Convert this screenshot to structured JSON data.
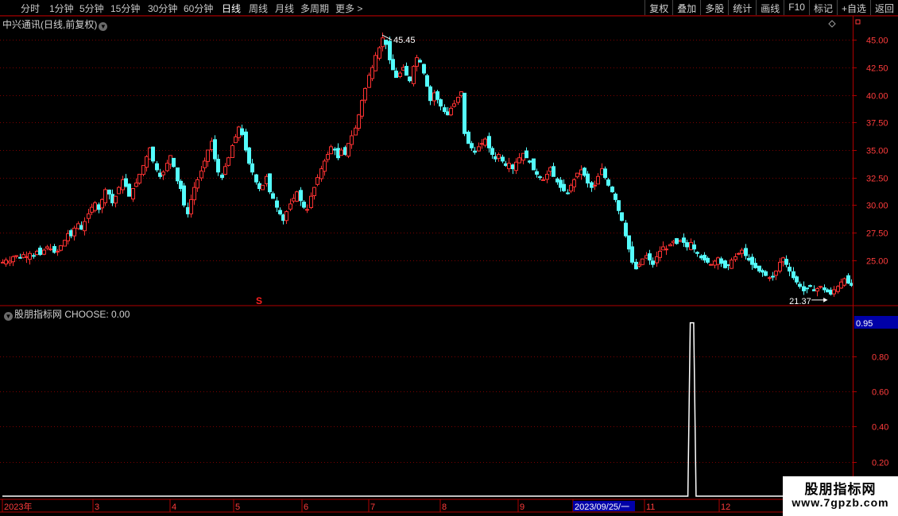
{
  "toolbar": {
    "timeframes": [
      "分时",
      "1分钟",
      "5分钟",
      "15分钟",
      "30分钟",
      "60分钟",
      "日线",
      "周线",
      "月线",
      "多周期",
      "更多 >"
    ],
    "active": "日线",
    "buttons": [
      "复权",
      "叠加",
      "多股",
      "统计",
      "画线",
      "F10",
      "标记",
      "+自选",
      "返回"
    ]
  },
  "main_title": "中兴通讯(日线,前复权)",
  "indicator_title": "股朋指标网  CHOOSE: 0.00",
  "watermark": {
    "line1": "股朋指标网",
    "line2": "www.7gpzb.com"
  },
  "colors": {
    "up": "#ff3232",
    "down": "#54fcfc",
    "axis": "#b00000",
    "grid": "#7a0000",
    "label": "#ff3c3c",
    "signal": "#ffffff",
    "badge": "#0000a8"
  },
  "chart_data": [
    {
      "type": "candlestick",
      "title": "中兴通讯(日线,前复权)",
      "x_labels": [
        "2023年",
        "3",
        "4",
        "5",
        "6",
        "7",
        "8",
        "9",
        "2023/09/25/一",
        "11",
        "12"
      ],
      "y_ticks": [
        25.0,
        27.5,
        30.0,
        32.5,
        35.0,
        37.5,
        40.0,
        42.5,
        45.0
      ],
      "ylim": [
        21.0,
        45.9
      ],
      "annotations": {
        "high_label": "45.45",
        "low_label": "21.37",
        "marker": "S"
      },
      "closes": [
        24.8,
        25.0,
        24.9,
        25.3,
        25.4,
        25.2,
        25.5,
        25.3,
        25.6,
        25.4,
        25.8,
        25.5,
        25.9,
        26.2,
        26.0,
        25.7,
        25.8,
        26.3,
        26.8,
        27.4,
        27.2,
        27.9,
        28.3,
        27.8,
        28.5,
        29.2,
        29.8,
        30.2,
        29.6,
        30.5,
        31.4,
        31.0,
        30.2,
        30.8,
        31.6,
        32.3,
        31.7,
        30.8,
        31.5,
        32.0,
        32.8,
        33.6,
        34.4,
        35.2,
        34.0,
        33.2,
        32.6,
        33.0,
        33.8,
        34.5,
        33.5,
        32.2,
        31.5,
        30.0,
        29.2,
        30.5,
        31.6,
        32.3,
        33.1,
        34.0,
        35.0,
        35.8,
        34.2,
        33.0,
        32.5,
        33.5,
        34.3,
        35.4,
        36.2,
        37.1,
        36.4,
        35.0,
        33.8,
        33.0,
        32.1,
        31.5,
        31.8,
        32.6,
        31.2,
        30.6,
        29.8,
        29.2,
        28.6,
        29.4,
        30.1,
        30.6,
        31.2,
        30.4,
        29.8,
        29.6,
        30.8,
        31.6,
        32.5,
        33.3,
        34.0,
        34.6,
        35.3,
        35.0,
        34.3,
        35.0,
        34.6,
        35.6,
        36.3,
        37.0,
        38.2,
        39.5,
        40.6,
        41.8,
        42.5,
        43.6,
        44.3,
        45.2,
        44.6,
        43.2,
        42.3,
        41.6,
        42.0,
        42.5,
        41.8,
        41.3,
        42.6,
        43.4,
        43.0,
        42.0,
        40.8,
        39.5,
        40.2,
        39.6,
        39.0,
        38.5,
        38.2,
        38.8,
        39.2,
        39.8,
        40.3,
        36.5,
        35.6,
        35.2,
        34.8,
        35.3,
        35.6,
        36.0,
        35.2,
        34.6,
        34.2,
        34.6,
        34.0,
        33.6,
        33.8,
        33.3,
        33.9,
        34.3,
        34.7,
        34.3,
        33.9,
        33.2,
        32.8,
        32.5,
        32.3,
        32.8,
        33.4,
        32.6,
        32.1,
        31.6,
        31.3,
        31.1,
        31.8,
        32.3,
        32.9,
        33.2,
        32.7,
        32.0,
        31.6,
        31.8,
        32.6,
        33.3,
        32.5,
        31.8,
        31.2,
        30.5,
        29.5,
        28.6,
        27.2,
        26.0,
        24.8,
        24.2,
        24.6,
        25.1,
        25.4,
        25.0,
        24.6,
        25.3,
        25.8,
        26.2,
        26.0,
        26.4,
        26.7,
        26.5,
        26.8,
        26.6,
        26.2,
        26.6,
        26.0,
        25.6,
        25.2,
        25.0,
        24.8,
        24.6,
        24.9,
        25.2,
        24.7,
        24.3,
        24.5,
        25.0,
        25.3,
        25.6,
        25.9,
        25.4,
        25.0,
        24.6,
        24.3,
        24.0,
        23.9,
        23.6,
        23.4,
        23.5,
        24.0,
        24.8,
        25.2,
        24.6,
        24.0,
        23.4,
        23.0,
        22.6,
        22.2,
        22.4,
        22.6,
        22.2,
        22.4,
        22.6,
        22.3,
        22.1,
        21.9,
        22.3,
        22.6,
        23.0,
        23.3,
        22.9,
        22.7
      ]
    },
    {
      "type": "line",
      "title": "股朋指标网  CHOOSE: 0.00",
      "y_ticks": [
        0.2,
        0.4,
        0.6,
        0.8
      ],
      "ylim": [
        0.0,
        1.02
      ],
      "current_label": "0.95",
      "signal_ranges": [
        [
          201,
          202
        ]
      ]
    }
  ]
}
